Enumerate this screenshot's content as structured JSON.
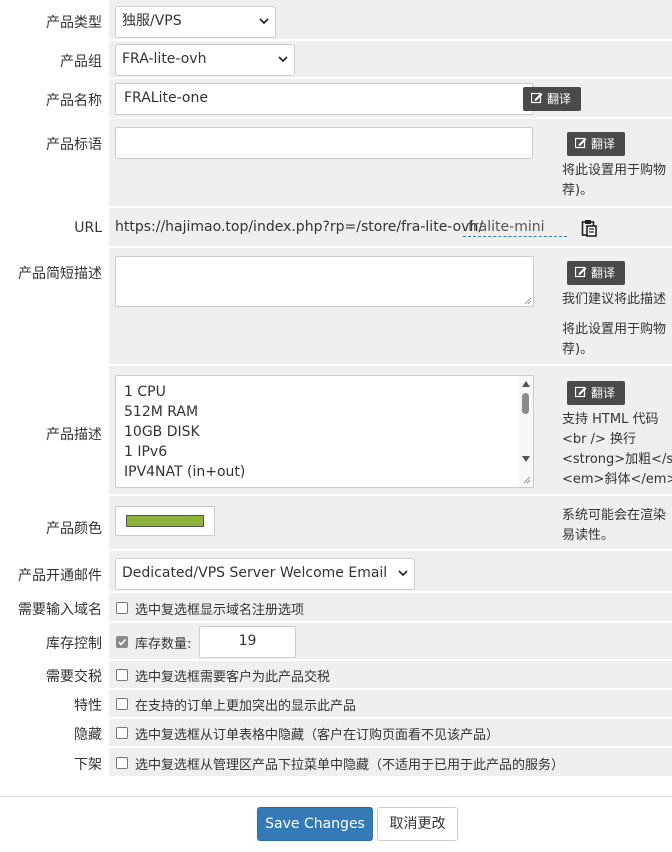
{
  "fields": {
    "product_type": {
      "label": "产品类型",
      "value": "独服/VPS"
    },
    "product_group": {
      "label": "产品组",
      "value": "FRA-lite-ovh"
    },
    "product_name": {
      "label": "产品名称",
      "value": "FRALite-one",
      "translate": "翻译"
    },
    "product_tagline": {
      "label": "产品标语",
      "value": "",
      "translate": "翻译",
      "help_line1": "将此设置用于购物",
      "help_line2": "荐)。"
    },
    "url": {
      "label": "URL",
      "base": "https://hajimao.top/index.php?rp=/store/fra-lite-ovh/",
      "slug": "fralite-mini"
    },
    "short_desc": {
      "label": "产品简短描述",
      "value": "",
      "translate": "翻译",
      "help_line1": "我们建议将此描述",
      "help_line2": "将此设置用于购物",
      "help_line3": "荐)。"
    },
    "description": {
      "label": "产品描述",
      "translate": "翻译",
      "lines": [
        "1 CPU",
        "512M RAM",
        "10GB DISK",
        "1 IPv6",
        "IPV4NAT (in+out)"
      ],
      "help_line1": "支持 HTML 代码",
      "help_line2": "<br /> 换行",
      "help_line3": "<strong>加粗</st",
      "help_line4": "<em>斜体</em>"
    },
    "color": {
      "label": "产品颜色",
      "swatch": "#8db33a",
      "help_line1": "系统可能会在渲染",
      "help_line2": "易读性。"
    },
    "welcome_email": {
      "label": "产品开通邮件",
      "value": "Dedicated/VPS Server Welcome Email"
    },
    "require_domain": {
      "label": "需要输入域名",
      "text": "选中复选框显示域名注册选项",
      "checked": false
    },
    "stock_control": {
      "label": "库存控制",
      "text": "库存数量:",
      "checked": true,
      "quantity": "19"
    },
    "require_tos": {
      "label": "需要交税",
      "text": "选中复选框需要客户为此产品交税",
      "checked": false
    },
    "featured": {
      "label": "特性",
      "text": "在支持的订单上更加突出的显示此产品",
      "checked": false
    },
    "hidden": {
      "label": "隐藏",
      "text": "选中复选框从订单表格中隐藏（客户在订购页面看不见该产品）",
      "checked": false
    },
    "retired": {
      "label": "下架",
      "text": "选中复选框从管理区产品下拉菜单中隐藏（不适用于已用于此产品的服务）",
      "checked": false
    }
  },
  "actions": {
    "save": "Save Changes",
    "cancel": "取消更改"
  },
  "colors": {
    "primary": "#337ab7",
    "field_bg": "#efefef",
    "translate_btn": "#4a4a4a"
  }
}
